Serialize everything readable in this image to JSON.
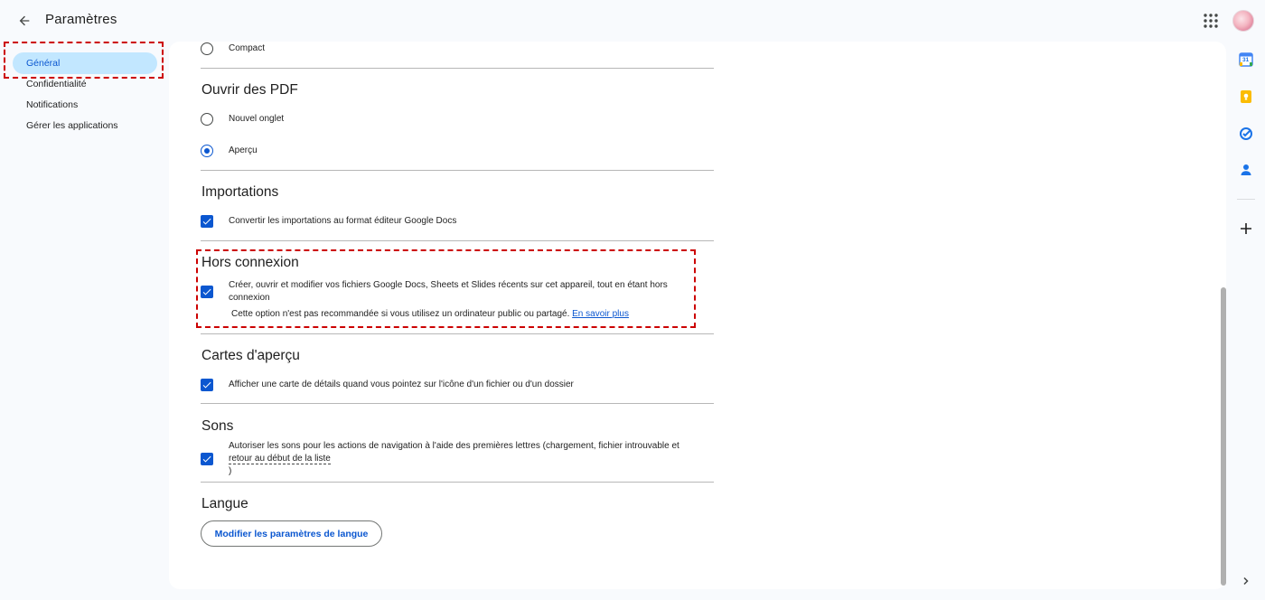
{
  "header": {
    "title": "Paramètres",
    "back_icon": "arrow-back-icon",
    "apps_icon": "apps-grid-icon"
  },
  "sidebar": {
    "items": [
      {
        "label": "Général",
        "active": true
      },
      {
        "label": "Confidentialité",
        "active": false
      },
      {
        "label": "Notifications",
        "active": false
      },
      {
        "label": "Gérer les applications",
        "active": false
      }
    ]
  },
  "density": {
    "compact_label": "Compact"
  },
  "pdf": {
    "title": "Ouvrir des PDF",
    "options": [
      {
        "label": "Nouvel onglet",
        "checked": false
      },
      {
        "label": "Aperçu",
        "checked": true
      }
    ]
  },
  "imports": {
    "title": "Importations",
    "convert_label": "Convertir les importations au format éditeur Google Docs"
  },
  "offline": {
    "title": "Hors connexion",
    "label_line1": "Créer, ouvrir et modifier vos fichiers Google Docs, Sheets et Slides récents sur cet appareil, tout en étant hors",
    "label_line2": "connexion",
    "note": "Cette option n'est pas recommandée si vous utilisez un ordinateur public ou partagé.",
    "link": "En savoir plus"
  },
  "preview_cards": {
    "title": "Cartes d'aperçu",
    "label": "Afficher une carte de détails quand vous pointez sur l'icône d'un fichier ou d'un dossier"
  },
  "sounds": {
    "title": "Sons",
    "label_line1": "Autoriser les sons pour les actions de navigation à l'aide des premières lettres (chargement, fichier introuvable et",
    "label_link": "retour au début de la liste",
    "label_close": ")"
  },
  "language": {
    "title": "Langue",
    "button": "Modifier les paramètres de langue"
  },
  "side_panel": {
    "icons": [
      "calendar-icon",
      "keep-icon",
      "tasks-icon",
      "contacts-icon",
      "add-icon",
      "expand-chevron-icon"
    ],
    "calendar_day": "31"
  },
  "colors": {
    "accent": "#0b57d0",
    "highlight": "#cc0000",
    "active_nav": "#c2e7ff"
  }
}
